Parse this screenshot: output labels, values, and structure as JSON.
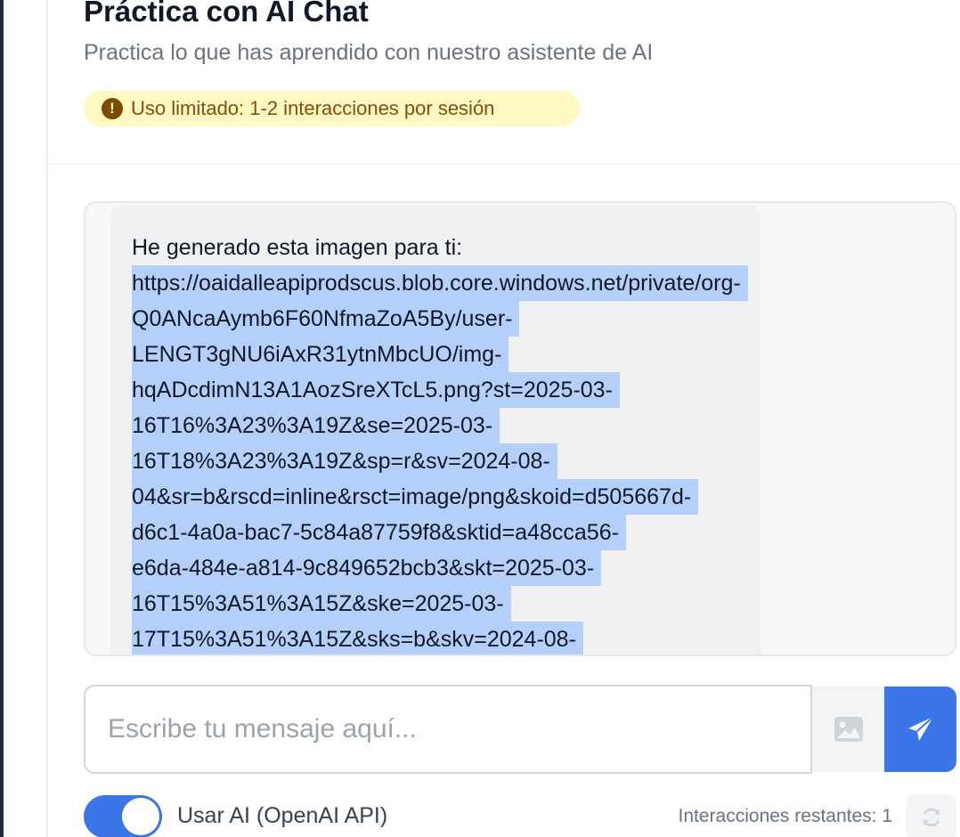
{
  "header": {
    "title": "Práctica con AI Chat",
    "subtitle": "Practica lo que has aprendido con nuestro asistente de AI",
    "badge": {
      "icon": "exclamation-circle-icon",
      "text": "Uso limitado: 1-2 interacciones por sesión"
    }
  },
  "chat": {
    "messages": [
      {
        "role": "assistant",
        "intro": "He generado esta imagen para ti:",
        "url_lines": [
          "https://oaidalleapiprodscus.blob.core.windows.net/private/org-",
          "Q0ANcaAymb6F60NfmaZoA5By/user-",
          "LENGT3gNU6iAxR31ytnMbcUO/img-",
          "hqADcdimN13A1AozSreXTcL5.png?st=2025-03-",
          "16T16%3A23%3A19Z&se=2025-03-",
          "16T18%3A23%3A19Z&sp=r&sv=2024-08-",
          "04&sr=b&rscd=inline&rsct=image/png&skoid=d505667d-",
          "d6c1-4a0a-bac7-5c84a87759f8&sktid=a48cca56-",
          "e6da-484e-a814-9c849652bcb3&skt=2025-03-",
          "16T15%3A51%3A15Z&ske=2025-03-",
          "17T15%3A51%3A15Z&sks=b&skv=2024-08-"
        ]
      }
    ]
  },
  "composer": {
    "placeholder": "Escribe tu mensaje aquí...",
    "value": "",
    "image_button_icon": "image-icon",
    "send_button_icon": "paper-plane-icon"
  },
  "footer": {
    "toggle_label": "Usar AI (OpenAI API)",
    "toggle_on": true,
    "remaining_text": "Interacciones restantes: 1",
    "reset_icon": "refresh-icon"
  },
  "colors": {
    "accent": "#3b76e8",
    "badge_bg": "#fef9c3",
    "badge_text": "#854d0e",
    "selection": "#b4cffa"
  }
}
